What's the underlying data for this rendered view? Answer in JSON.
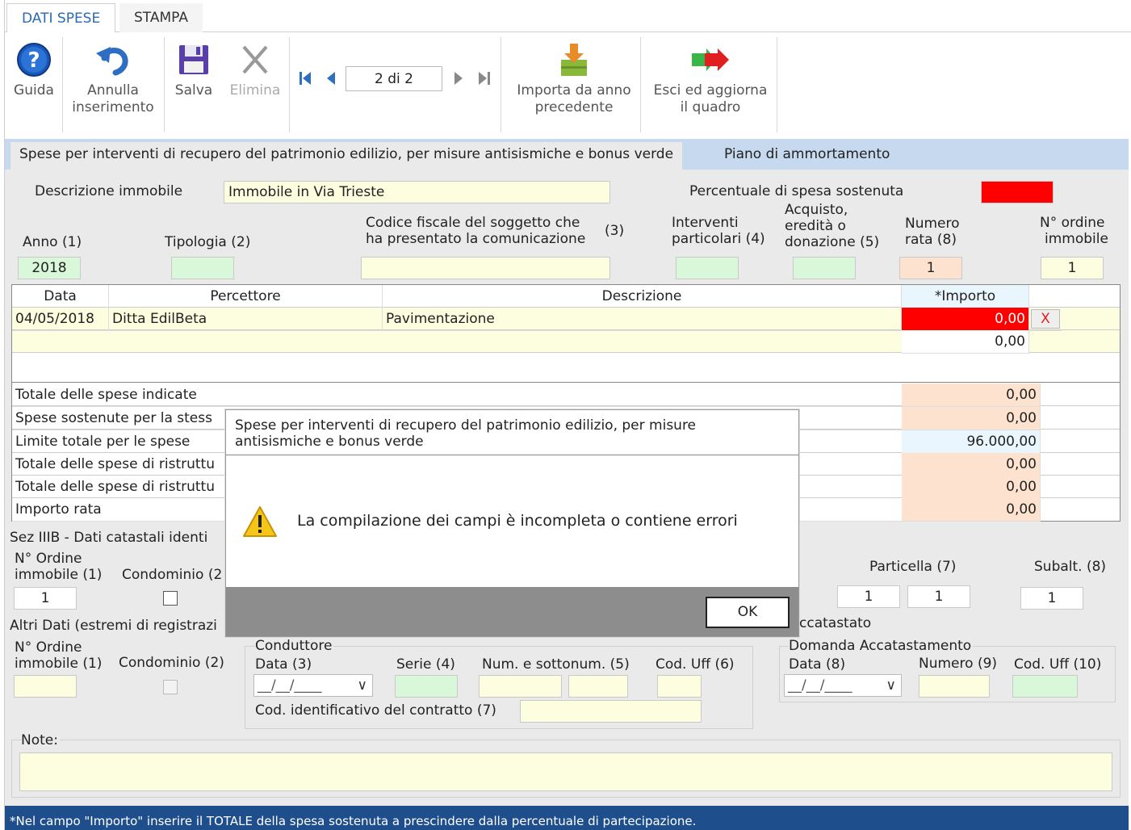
{
  "menu": {
    "tabs": [
      {
        "label": "DATI SPESE"
      },
      {
        "label": "STAMPA"
      }
    ]
  },
  "toolbar": {
    "guida": "Guida",
    "annulla_1": "Annulla",
    "annulla_2": "inserimento",
    "salva": "Salva",
    "elimina": "Elimina",
    "pager": "2 di 2",
    "importa_1": "Importa da anno",
    "importa_2": "precedente",
    "esci_1": "Esci ed aggiorna",
    "esci_2": "il quadro"
  },
  "subtabs": [
    {
      "label": "Spese per interventi di recupero del patrimonio edilizio, per misure antisismiche e bonus verde"
    },
    {
      "label": "Piano di ammortamento"
    }
  ],
  "form": {
    "descrizione_label": "Descrizione immobile",
    "descrizione_value": "Immobile in Via Trieste",
    "percentuale_label": "Percentuale di spesa sostenuta",
    "anno_label": "Anno",
    "anno_note": "(1)",
    "anno_value": "2018",
    "tipologia_label": "Tipologia",
    "tipologia_note": "(2)",
    "cf_label_1": "Codice fiscale del soggetto che",
    "cf_label_2": "ha presentato la comunicazione",
    "cf_note": "(3)",
    "interventi_1": "Interventi",
    "interventi_2": "particolari",
    "interventi_note": "(4)",
    "acquisto_1": "Acquisto,",
    "acquisto_2": "eredità o",
    "acquisto_3": "donazione",
    "acquisto_note": "(5)",
    "numero_1": "Numero",
    "numero_2": "rata",
    "numero_note": "(8)",
    "numero_value": "1",
    "ordine_1": "N° ordine",
    "ordine_2": "immobile",
    "ordine_value": "1"
  },
  "table": {
    "headers": [
      "Data",
      "Percettore",
      "Descrizione",
      "*Importo"
    ],
    "rows": [
      {
        "data": "04/05/2018",
        "percettore": "Ditta EdilBeta",
        "descrizione": "Pavimentazione",
        "importo": "0,00",
        "delete": "X"
      },
      {
        "data": "",
        "percettore": "",
        "descrizione": "",
        "importo": "0,00"
      }
    ]
  },
  "totals": [
    {
      "label": "Totale delle spese indicate",
      "value": "0,00"
    },
    {
      "label": "Spese sostenute per la stess",
      "value": "0,00"
    },
    {
      "label": "Limite totale per le spese",
      "value": "96.000,00"
    },
    {
      "label": "Totale delle spese di ristruttu",
      "value": "0,00"
    },
    {
      "label": "Totale delle spese di ristruttu",
      "value": "0,00"
    },
    {
      "label": "Importo rata",
      "value": "0,00"
    }
  ],
  "catasto": {
    "title": "Sez IIIB - Dati catastali identi",
    "ordine_1": "N° Ordine",
    "ordine_2": "immobile",
    "ordine_note": "(1)",
    "condominio": "Condominio (2",
    "ordine_value": "1",
    "particella": "Particella",
    "particella_note": "(7)",
    "particella_value": "1",
    "subalt": "Subalt.",
    "subalt_note": "(8)",
    "subalt_value": "1",
    "other_value": "1"
  },
  "altri": {
    "title": "Altri Dati (estremi di registrazi",
    "accatastato": "ccatastato",
    "ordine_1": "N° Ordine",
    "ordine_2": "immobile",
    "ordine_note": "(1)",
    "condominio": "Condominio",
    "condominio_note": "(2)",
    "conduttore": "Conduttore",
    "data": "Data",
    "data_note": "(3)",
    "serie": "Serie",
    "serie_note": "(4)",
    "num": "Num. e sottonum.",
    "num_note": "(5)",
    "codu": "Cod. Uff",
    "codu_note": "(6)",
    "codid": "Cod. identificativo del contratto",
    "codid_note": "(7)",
    "date_placeholder": "__/__/____",
    "domanda": "Domanda Accatastamento",
    "data2": "Data",
    "data2_note": "(8)",
    "numero": "Numero",
    "numero_note": "(9)",
    "codu2": "Cod. Uff",
    "codu2_note": "(10)"
  },
  "note": {
    "label": "Note:"
  },
  "footer": {
    "text": "*Nel campo \"Importo\" inserire il TOTALE della spesa sostenuta a prescindere dalla percentuale di partecipazione."
  },
  "dialog": {
    "title_1": "Spese per interventi di recupero del patrimonio edilizio, per misure",
    "title_2": "antisismiche e bonus verde",
    "message": "La compilazione dei campi è incompleta o contiene errori",
    "ok": "OK"
  },
  "colors": {
    "error": "#ff0000",
    "footer": "#1f4e8c",
    "tab_strip": "#c6d9ee"
  }
}
